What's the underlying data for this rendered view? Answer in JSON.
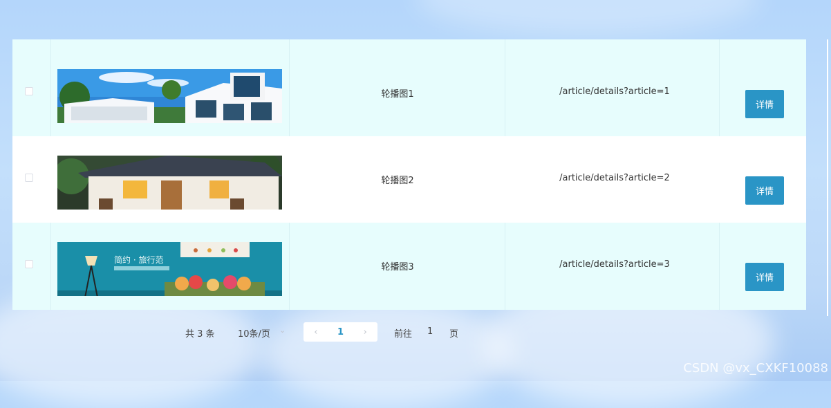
{
  "table": {
    "rows": [
      {
        "name": "轮播图1",
        "url": "/article/details?article=1",
        "button": "详情"
      },
      {
        "name": "轮播图2",
        "url": "/article/details?article=2",
        "button": "详情"
      },
      {
        "name": "轮播图3",
        "url": "/article/details?article=3",
        "button": "详情"
      }
    ],
    "banner3": {
      "title": "简约 · 旅行范"
    }
  },
  "pagination": {
    "total": "共 3 条",
    "page_size": "10条/页",
    "current_page": "1",
    "goto_label": "前往",
    "goto_value": "1",
    "page_suffix": "页"
  },
  "watermark": "CSDN @vx_CXKF10088",
  "colors": {
    "accent": "#2a95c6",
    "row_tint": "#e7fdfd"
  }
}
